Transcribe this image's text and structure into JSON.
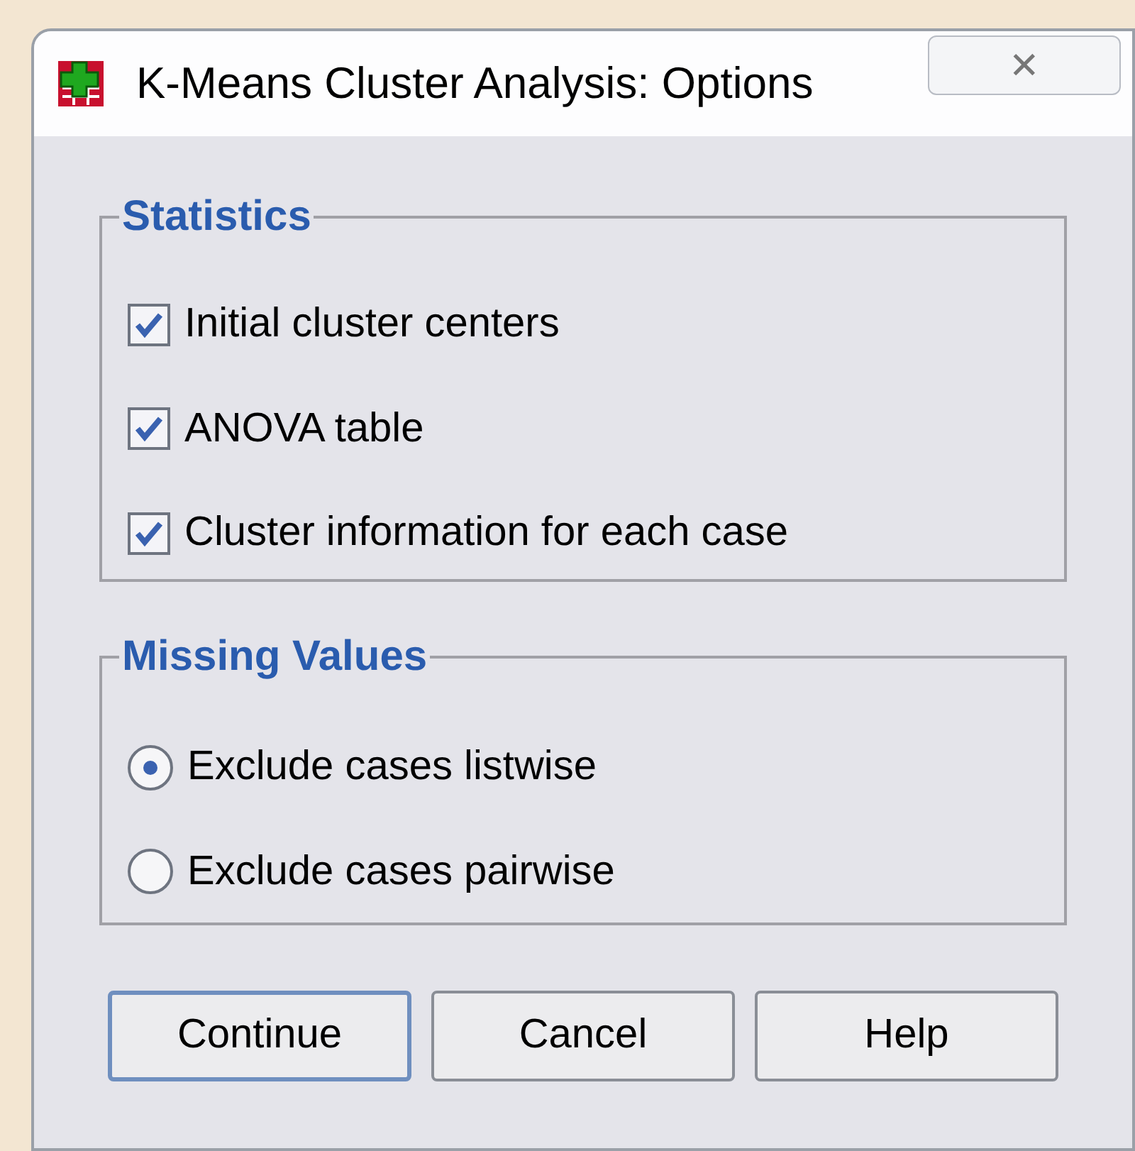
{
  "window": {
    "title": "K-Means Cluster Analysis: Options",
    "close_button": "✕"
  },
  "statistics": {
    "title": "Statistics",
    "options": [
      {
        "label": "Initial cluster centers",
        "checked": true
      },
      {
        "label": "ANOVA table",
        "checked": true
      },
      {
        "label": "Cluster information for each case",
        "checked": true
      }
    ]
  },
  "missing_values": {
    "title": "Missing Values",
    "options": [
      {
        "label": "Exclude cases listwise",
        "selected": true
      },
      {
        "label": "Exclude cases pairwise",
        "selected": false
      }
    ]
  },
  "buttons": [
    {
      "label": "Continue",
      "default": true
    },
    {
      "label": "Cancel",
      "default": false
    },
    {
      "label": "Help",
      "default": false
    }
  ]
}
